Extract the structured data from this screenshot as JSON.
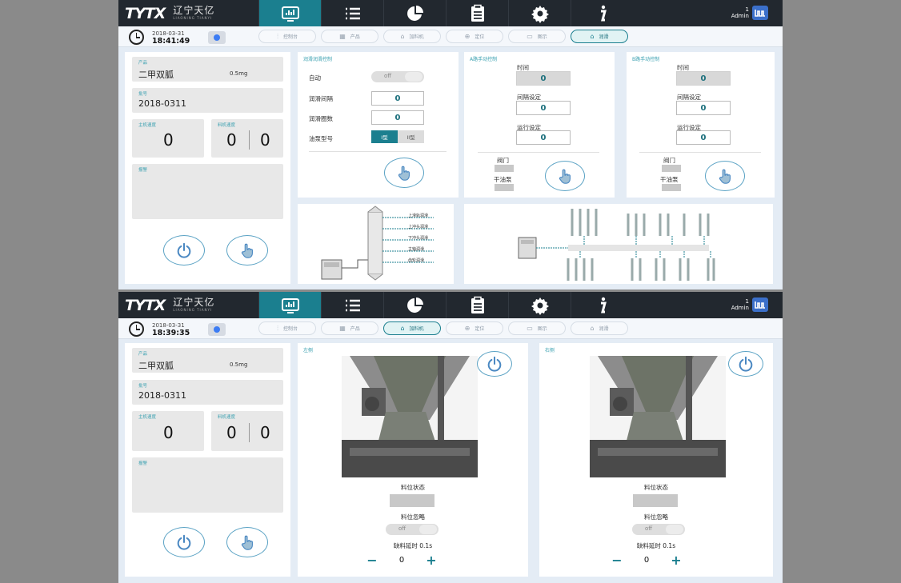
{
  "app": {
    "logo_mark": "TYTX",
    "logo_cn": "辽宁天亿",
    "logo_en": "LIAONING TIANYI",
    "user_num": "1",
    "user_name": "Admin",
    "nav": [
      {
        "icon": "dashboard-monitor-icon"
      },
      {
        "icon": "list-icon"
      },
      {
        "icon": "pie-chart-icon"
      },
      {
        "icon": "clipboard-icon"
      },
      {
        "icon": "gear-icon"
      },
      {
        "icon": "info-icon"
      }
    ],
    "tabs": [
      "控制台",
      "产品",
      "加料机",
      "定位",
      "图示",
      "润滑"
    ],
    "accent": "#1b7f8f"
  },
  "screen1": {
    "date": "2018-03-31",
    "time": "18:41:49",
    "active_tab": "润滑",
    "left": {
      "product_label": "产品",
      "product_name": "二甲双胍",
      "product_qty": "0.5mg",
      "batch_label": "批号",
      "batch_value": "2018-0311",
      "main_speed_label": "主机速度",
      "main_speed": "0",
      "feed_speed_label": "料机速度",
      "feed_speed_a": "0",
      "feed_speed_b": "0",
      "alarm_label": "报警"
    },
    "lube_panel": {
      "title": "润滑润滑控制",
      "auto_label": "自动",
      "auto_toggle": "off",
      "interval_label": "润滑间隔",
      "interval_value": "0",
      "count_label": "润滑圈数",
      "count_value": "0",
      "pump_label": "油泵型号",
      "pump_opt1": "I型",
      "pump_opt2": "II型"
    },
    "manual1": {
      "title": "A路手动控制",
      "time_label": "时间",
      "time_value": "0",
      "interval_label": "间隔设定",
      "interval_value": "0",
      "run_label": "运行设定",
      "run_value": "0",
      "valve_label": "阀门",
      "pump_label": "干油泵"
    },
    "manual2": {
      "title": "B路手动控制",
      "time_label": "时间",
      "time_value": "0",
      "interval_label": "间隔设定",
      "interval_value": "0",
      "run_label": "运行设定",
      "run_value": "0",
      "valve_label": "阀门",
      "pump_label": "干油泵"
    },
    "diagram1": {
      "labels": [
        "上滑轨润滑",
        "上冲头润滑",
        "下冲头润滑",
        "主轴润滑",
        "齿轮润滑"
      ]
    }
  },
  "screen2": {
    "date": "2018-03-31",
    "time": "18:39:35",
    "active_tab": "加料机",
    "left": {
      "product_label": "产品",
      "product_name": "二甲双胍",
      "product_qty": "0.5mg",
      "batch_label": "批号",
      "batch_value": "2018-0311",
      "main_speed_label": "主机速度",
      "main_speed": "0",
      "feed_speed_label": "料机速度",
      "feed_speed_a": "0",
      "feed_speed_b": "0",
      "alarm_label": "报警"
    },
    "left_feeder": {
      "title": "左侧",
      "level_status_label": "料位状态",
      "level_mask_label": "料位忽略",
      "mask_toggle": "off",
      "delay_label": "缺料延时 0.1s",
      "delay_value": "0"
    },
    "right_feeder": {
      "title": "右侧",
      "level_status_label": "料位状态",
      "level_mask_label": "料位忽略",
      "mask_toggle": "off",
      "delay_label": "缺料延时 0.1s",
      "delay_value": "0"
    }
  }
}
